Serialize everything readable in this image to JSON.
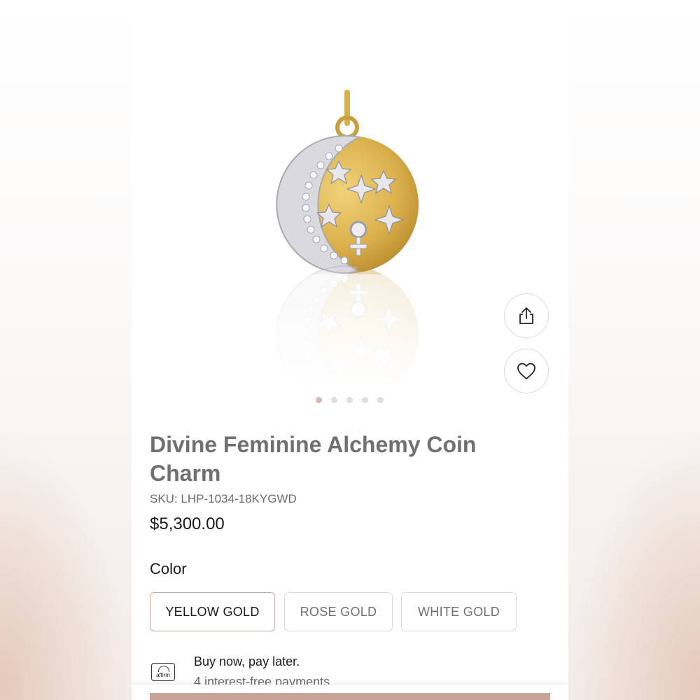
{
  "product": {
    "title": "Divine Feminine Alchemy Coin Charm",
    "sku": "SKU: LHP-1034-18KYGWD",
    "price": "$5,300.00",
    "image_count": 5,
    "active_image": 1
  },
  "actions": {
    "share_icon": "share-icon",
    "favorite_icon": "heart-icon"
  },
  "color": {
    "label": "Color",
    "options": [
      "YELLOW GOLD",
      "ROSE GOLD",
      "WHITE GOLD"
    ],
    "selected": "YELLOW GOLD"
  },
  "financing": {
    "logo_text": "affirm",
    "headline": "Buy now, pay later.",
    "subline": "4 interest-free payments"
  },
  "colors": {
    "accent": "#c7a497",
    "selected_border": "#caa79c",
    "title_gray": "#707070",
    "gold": "#d9b24a"
  }
}
